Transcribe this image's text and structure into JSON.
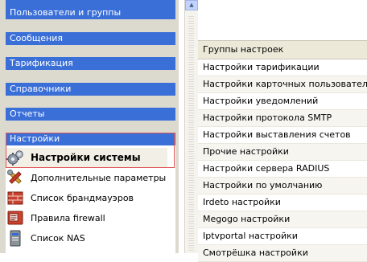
{
  "sidebar": {
    "sections": [
      {
        "label": "Пользователи и группы"
      },
      {
        "label": "Сообщения"
      },
      {
        "label": "Тарификация"
      },
      {
        "label": "Справочники"
      },
      {
        "label": "Отчеты"
      }
    ],
    "active_section": {
      "label": "Настройки",
      "items": [
        {
          "label": "Настройки системы",
          "icon": "gears-icon"
        },
        {
          "label": "Дополнительные параметры",
          "icon": "tools-icon"
        },
        {
          "label": "Список брандмауэров",
          "icon": "firewall-icon"
        },
        {
          "label": "Правила firewall",
          "icon": "firewall-rules-icon"
        },
        {
          "label": "Список NAS",
          "icon": "server-icon"
        }
      ]
    }
  },
  "table": {
    "header": "Группы настроек",
    "rows": [
      {
        "label": "Настройки тарификации"
      },
      {
        "label": "Настройки карточных пользователей"
      },
      {
        "label": "Настройки уведомлений"
      },
      {
        "label": "Настройки протокола SMTP"
      },
      {
        "label": "Настройки выставления счетов"
      },
      {
        "label": "Прочие настройки"
      },
      {
        "label": "Настройки сервера RADIUS"
      },
      {
        "label": "Настройки по умолчанию"
      },
      {
        "label": "Irdeto настройки"
      },
      {
        "label": "Megogo настройки"
      },
      {
        "label": "Iptvportal настройки"
      },
      {
        "label": "Смотрёшка настройки"
      }
    ]
  },
  "colors": {
    "section_header": "#3a6fd8",
    "sidebar_bg": "#dcd9cf",
    "selection_border": "#e05555",
    "table_header_bg": "#ece9d8"
  }
}
